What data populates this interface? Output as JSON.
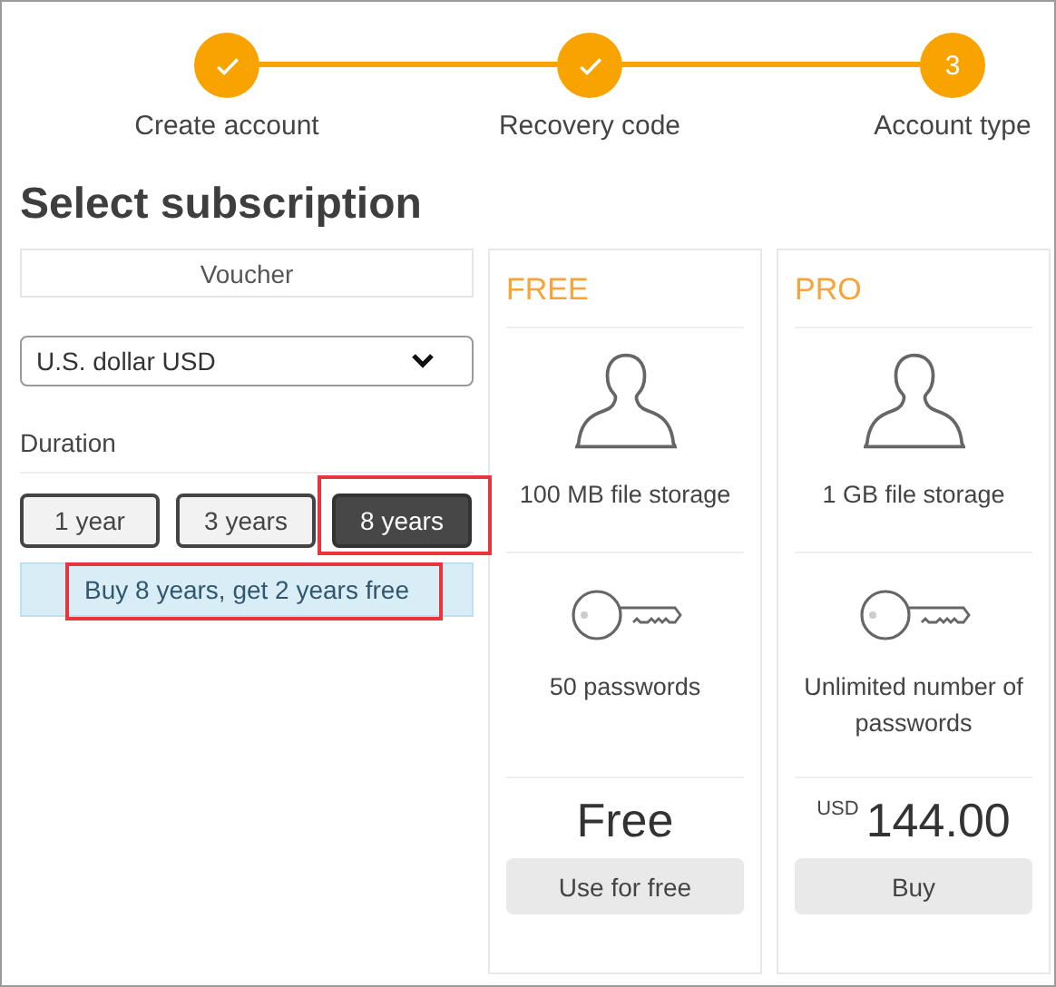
{
  "steps": [
    {
      "label": "Create account",
      "completed": true
    },
    {
      "label": "Recovery code",
      "completed": true
    },
    {
      "label": "Account type",
      "completed": false,
      "number": "3"
    }
  ],
  "title": "Select subscription",
  "voucher": {
    "placeholder": "Voucher"
  },
  "currency": {
    "value": "U.S. dollar USD"
  },
  "duration": {
    "label": "Duration",
    "options": [
      {
        "label": "1 year",
        "selected": false,
        "highlighted": false
      },
      {
        "label": "3 years",
        "selected": false,
        "highlighted": false
      },
      {
        "label": "8 years",
        "selected": true,
        "highlighted": true
      }
    ]
  },
  "promo": {
    "text": "Buy 8 years, get 2 years free",
    "highlighted": true
  },
  "plans": [
    {
      "name": "FREE",
      "features": [
        {
          "kind": "storage",
          "text": "100 MB file storage"
        },
        {
          "kind": "passwords",
          "text": "50 passwords"
        }
      ],
      "price": {
        "amount": "Free"
      },
      "button": "Use for free"
    },
    {
      "name": "PRO",
      "features": [
        {
          "kind": "storage",
          "text": "1 GB file storage"
        },
        {
          "kind": "passwords",
          "text": "Unlimited number of passwords"
        }
      ],
      "price": {
        "currency": "USD",
        "amount": "144.00"
      },
      "button": "Buy"
    }
  ]
}
